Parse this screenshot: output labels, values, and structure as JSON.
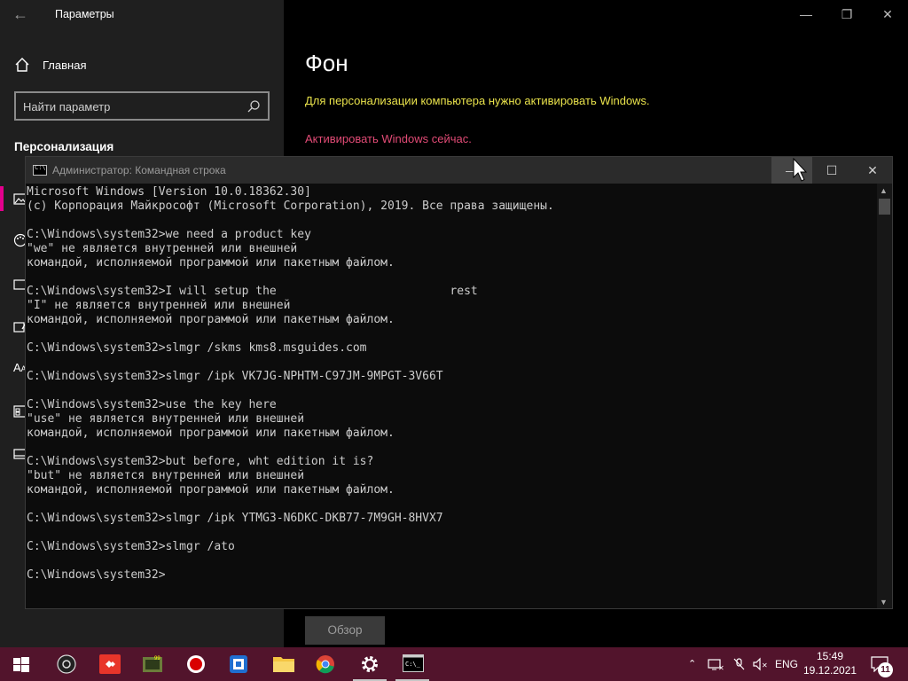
{
  "settings": {
    "window_title": "Параметры",
    "home_label": "Главная",
    "search_placeholder": "Найти параметр",
    "section_title": "Персонализация",
    "page_heading": "Фон",
    "activation_warning": "Для персонализации компьютера нужно активировать Windows.",
    "activate_link": "Активировать Windows сейчас.",
    "browse_button": "Обзор",
    "icons": [
      "back-arrow-icon",
      "home-icon",
      "search-icon",
      "image-icon",
      "palette-icon",
      "lock-screen-icon",
      "theme-icon",
      "font-icon",
      "start-icon",
      "taskbar-icon"
    ]
  },
  "cmd": {
    "window_title": "Администратор: Командная строка",
    "lines": [
      "Microsoft Windows [Version 10.0.18362.30]",
      "(c) Корпорация Майкрософт (Microsoft Corporation), 2019. Все права защищены.",
      "",
      "C:\\Windows\\system32>we need a product key",
      "\"we\" не является внутренней или внешней",
      "командой, исполняемой программой или пакетным файлом.",
      "",
      "C:\\Windows\\system32>I will setup the                         rest",
      "\"I\" не является внутренней или внешней",
      "командой, исполняемой программой или пакетным файлом.",
      "",
      "C:\\Windows\\system32>slmgr /skms kms8.msguides.com",
      "",
      "C:\\Windows\\system32>slmgr /ipk VK7JG-NPHTM-C97JM-9MPGT-3V66T",
      "",
      "C:\\Windows\\system32>use the key here",
      "\"use\" не является внутренней или внешней",
      "командой, исполняемой программой или пакетным файлом.",
      "",
      "C:\\Windows\\system32>but before, wht edition it is?",
      "\"but\" не является внутренней или внешней",
      "командой, исполняемой программой или пакетным файлом.",
      "",
      "C:\\Windows\\system32>slmgr /ipk YTMG3-N6DKC-DKB77-7M9GH-8HVX7",
      "",
      "C:\\Windows\\system32>slmgr /ato",
      "",
      "C:\\Windows\\system32>"
    ]
  },
  "taskbar": {
    "apps": [
      "start-button",
      "obs-icon",
      "anydesk-icon",
      "game-icon",
      "record-icon",
      "video-icon",
      "file-explorer-icon",
      "chrome-icon",
      "settings-icon",
      "cmd-icon"
    ],
    "language": "ENG",
    "time": "15:49",
    "date": "19.12.2021",
    "notification_count": "11"
  },
  "colors": {
    "accent": "#e3008c",
    "taskbar": "#52142c",
    "warning": "#e9e24b",
    "link": "#e24b76"
  }
}
